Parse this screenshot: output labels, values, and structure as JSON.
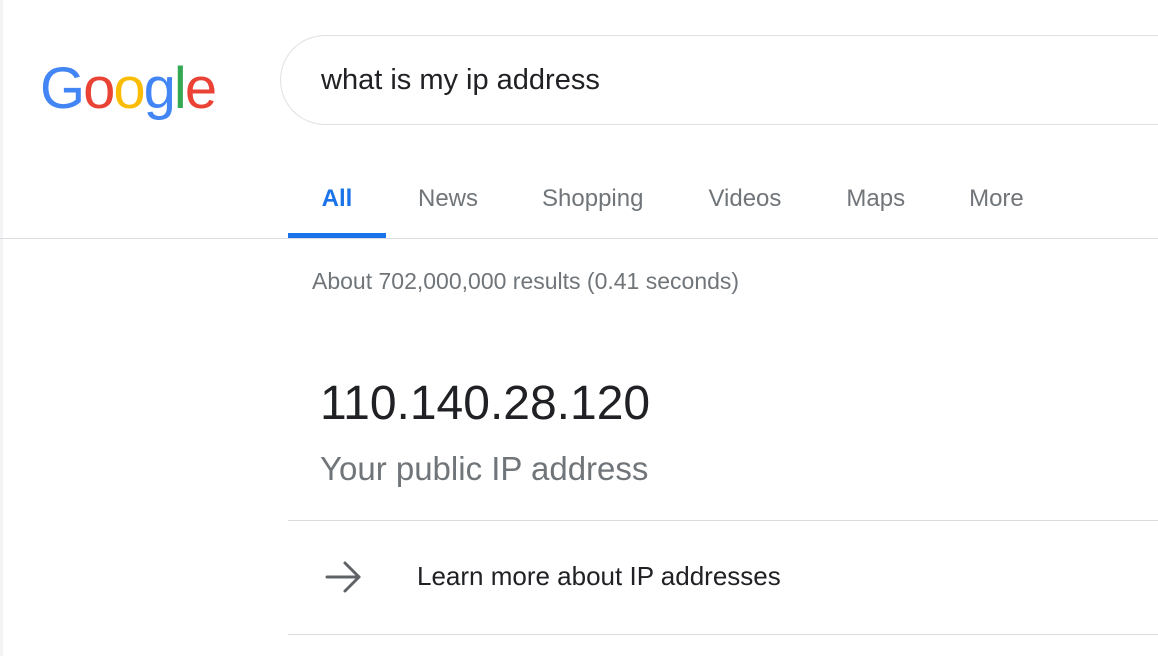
{
  "logo": {
    "letters": [
      {
        "char": "G",
        "color": "#4285F4"
      },
      {
        "char": "o",
        "color": "#EA4335"
      },
      {
        "char": "o",
        "color": "#FBBC05"
      },
      {
        "char": "g",
        "color": "#4285F4"
      },
      {
        "char": "l",
        "color": "#34A853"
      },
      {
        "char": "e",
        "color": "#EA4335"
      }
    ]
  },
  "search": {
    "value": "what is my ip address"
  },
  "tabs": [
    {
      "label": "All",
      "active": true
    },
    {
      "label": "News",
      "active": false
    },
    {
      "label": "Shopping",
      "active": false
    },
    {
      "label": "Videos",
      "active": false
    },
    {
      "label": "Maps",
      "active": false
    },
    {
      "label": "More",
      "active": false
    }
  ],
  "results": {
    "stats": "About 702,000,000 results (0.41 seconds)"
  },
  "ip_card": {
    "ip": "110.140.28.120",
    "caption": "Your public IP address",
    "learn_more": "Learn more about IP addresses",
    "learn_more_icon": "arrow-right-icon"
  },
  "colors": {
    "accent": "#1a73e8",
    "muted_text": "#70757a",
    "primary_text": "#202124",
    "divider": "#dadce0"
  }
}
